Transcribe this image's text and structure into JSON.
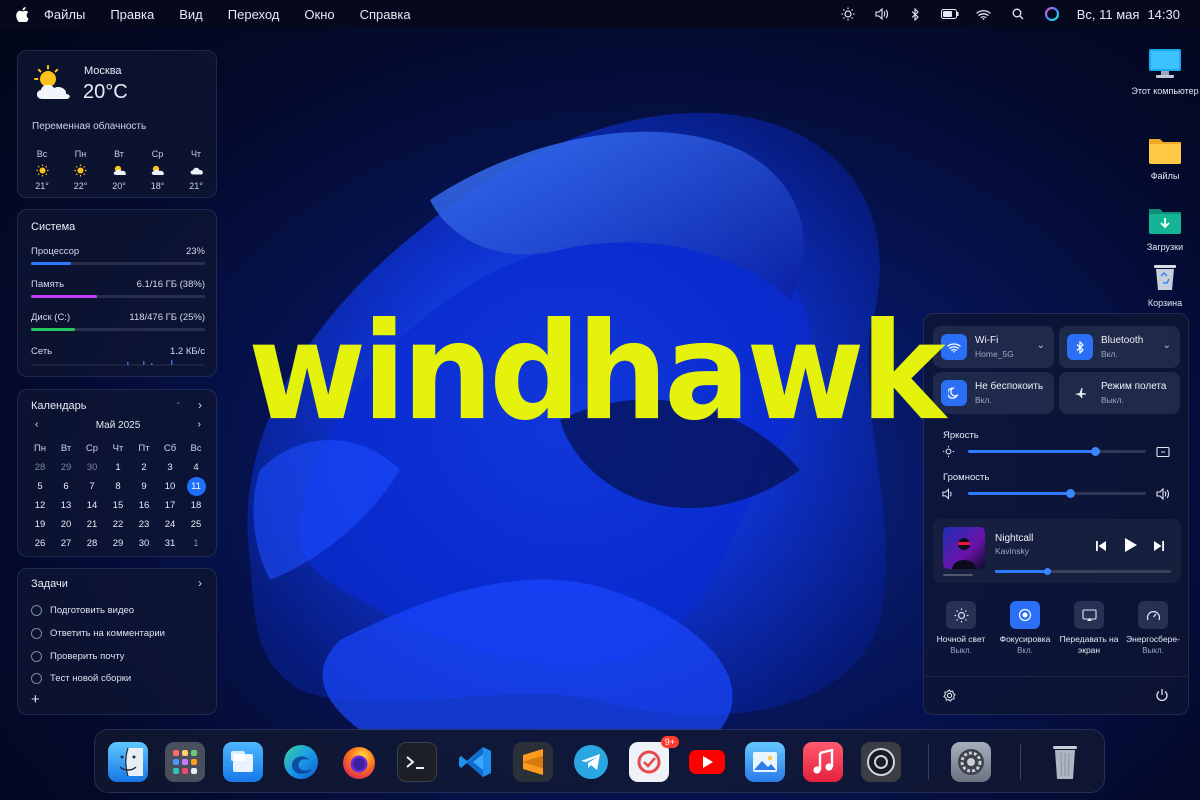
{
  "menubar": {
    "items": [
      "Файлы",
      "Правка",
      "Вид",
      "Переход",
      "Окно",
      "Справка"
    ],
    "date": "Вс, 11 мая",
    "time": "14:30"
  },
  "weather": {
    "city": "Москва",
    "temp": "20°C",
    "condition": "Переменная облачность",
    "forecast": [
      {
        "day": "Вс",
        "temp": "21°",
        "icon": "sun-icon"
      },
      {
        "day": "Пн",
        "temp": "22°",
        "icon": "sun-icon"
      },
      {
        "day": "Вт",
        "temp": "20°",
        "icon": "partly-cloudy-icon"
      },
      {
        "day": "Ср",
        "temp": "18°",
        "icon": "partly-cloudy-icon"
      },
      {
        "day": "Чт",
        "temp": "21°",
        "icon": "cloud-icon"
      }
    ]
  },
  "system": {
    "title": "Система",
    "cpu": {
      "label": "Процессор",
      "value": "23%",
      "fraction": 0.23,
      "color": "#2f7bff"
    },
    "mem": {
      "label": "Память",
      "value": "6.1/16 ГБ (38%)",
      "fraction": 0.38,
      "color": "#c23dff"
    },
    "disk": {
      "label": "Диск (C:)",
      "value": "118/476 ГБ (25%)",
      "fraction": 0.25,
      "color": "#22c55e"
    },
    "net": {
      "label": "Сеть",
      "value": "1.2 КБ/с"
    }
  },
  "calendar": {
    "title": "Календарь",
    "month": "Май 2025",
    "headers": [
      "Пн",
      "Вт",
      "Ср",
      "Чт",
      "Пт",
      "Сб",
      "Вс"
    ],
    "days": [
      {
        "d": "28",
        "dim": true
      },
      {
        "d": "29",
        "dim": true
      },
      {
        "d": "30",
        "dim": true
      },
      {
        "d": "1"
      },
      {
        "d": "2"
      },
      {
        "d": "3"
      },
      {
        "d": "4"
      },
      {
        "d": "5"
      },
      {
        "d": "6"
      },
      {
        "d": "7"
      },
      {
        "d": "8"
      },
      {
        "d": "9"
      },
      {
        "d": "10"
      },
      {
        "d": "11",
        "today": true
      },
      {
        "d": "12"
      },
      {
        "d": "13"
      },
      {
        "d": "14"
      },
      {
        "d": "15"
      },
      {
        "d": "16"
      },
      {
        "d": "17"
      },
      {
        "d": "18"
      },
      {
        "d": "19"
      },
      {
        "d": "20"
      },
      {
        "d": "21"
      },
      {
        "d": "22"
      },
      {
        "d": "23"
      },
      {
        "d": "24"
      },
      {
        "d": "25"
      },
      {
        "d": "26"
      },
      {
        "d": "27"
      },
      {
        "d": "28"
      },
      {
        "d": "29"
      },
      {
        "d": "30"
      },
      {
        "d": "31"
      },
      {
        "d": "1",
        "dim": true
      }
    ]
  },
  "tasks": {
    "title": "Задачи",
    "items": [
      "Подготовить видео",
      "Ответить на комментарии",
      "Проверить почту",
      "Тест новой сборки"
    ]
  },
  "logo": "windhawk",
  "desktop": {
    "icons": [
      {
        "label": "Этот компьютер",
        "icon": "monitor-icon"
      },
      {
        "label": "Файлы",
        "icon": "folder-icon"
      },
      {
        "label": "Загрузки",
        "icon": "downloads-folder-icon"
      },
      {
        "label": "Корзина",
        "icon": "recycle-bin-icon"
      }
    ]
  },
  "control_center": {
    "wifi": {
      "label": "Wi-Fi",
      "sub": "Home_5G"
    },
    "bluetooth": {
      "label": "Bluetooth",
      "sub": "Вкл."
    },
    "dnd": {
      "label": "Не беспокоить",
      "sub": "Вкл."
    },
    "airplane": {
      "label": "Режим полета",
      "sub": "Выкл."
    },
    "brightness": {
      "label": "Яркость",
      "level": 0.72
    },
    "volume": {
      "label": "Громность",
      "level": 0.58
    },
    "player": {
      "song": "Nightcall",
      "artist": "Kavinsky",
      "progress": 0.3
    },
    "quick": [
      {
        "l1": "Ночной свет",
        "l2": "Выкл.",
        "on": false
      },
      {
        "l1": "Фокусировка",
        "l2": "Вкл.",
        "on": true
      },
      {
        "l1": "Передавать на экран",
        "l2": "",
        "on": false
      },
      {
        "l1": "Энергосбере-",
        "l2": "Выкл.",
        "on": false
      }
    ]
  },
  "dock": {
    "apps": [
      "finder",
      "launchpad",
      "explorer",
      "edge",
      "firefox",
      "terminal",
      "vscode",
      "sublime",
      "telegram",
      "todo",
      "youtube",
      "photos",
      "music",
      "obs",
      "settings",
      "trash"
    ],
    "badge": "9+"
  }
}
